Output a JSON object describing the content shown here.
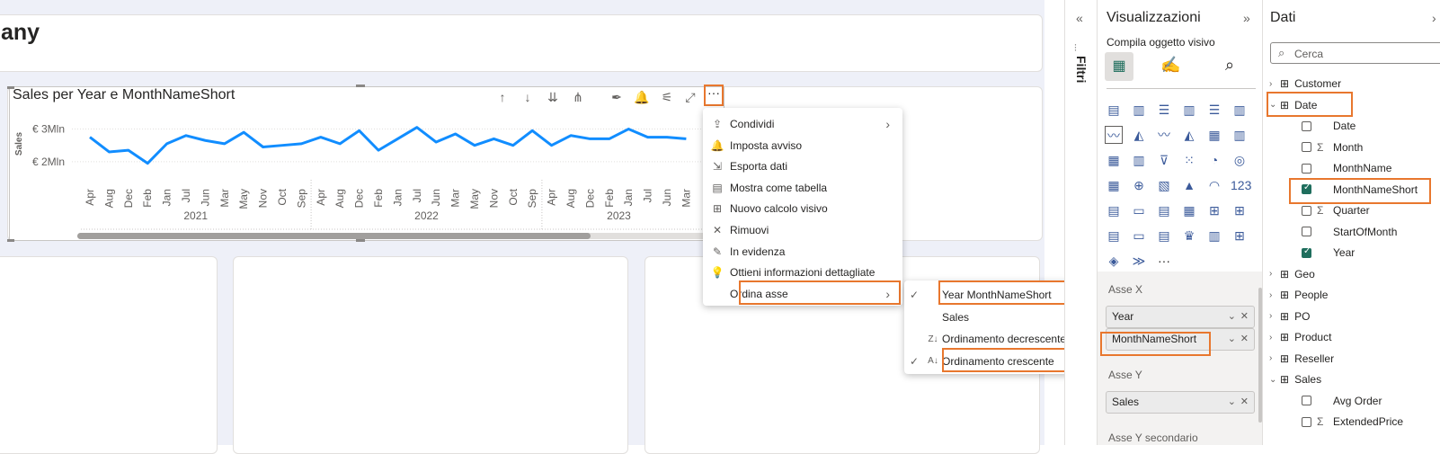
{
  "report": {
    "page_title": "any",
    "visual_title": "Sales per Year e MonthNameShort"
  },
  "visual_header": {
    "more_label": "···"
  },
  "chart_data": {
    "type": "line",
    "title": "Sales per Year e MonthNameShort",
    "ylabel": "Sales",
    "ytick_labels": [
      "€ 3Mln",
      "€ 2Mln"
    ],
    "yticks": [
      3000000,
      2000000
    ],
    "ylim": [
      1500000,
      3400000
    ],
    "x": [
      "Apr",
      "Aug",
      "Dec",
      "Feb",
      "Jan",
      "Jul",
      "Jun",
      "Mar",
      "May",
      "Nov",
      "Oct",
      "Sep",
      "Apr",
      "Aug",
      "Dec",
      "Feb",
      "Jan",
      "Jul",
      "Jun",
      "Mar",
      "May",
      "Nov",
      "Oct",
      "Sep",
      "Apr",
      "Aug",
      "Dec",
      "Feb",
      "Jan",
      "Jul",
      "Jun",
      "Mar"
    ],
    "x_groups": [
      {
        "label": "2021",
        "count": 12
      },
      {
        "label": "2022",
        "count": 12
      },
      {
        "label": "2023",
        "count": 8
      }
    ],
    "series": [
      {
        "values": [
          2750000,
          2300000,
          2350000,
          1950000,
          2550000,
          2800000,
          2650000,
          2550000,
          2900000,
          2450000,
          2500000,
          2550000,
          2750000,
          2550000,
          2950000,
          2350000,
          2700000,
          3050000,
          2600000,
          2850000,
          2500000,
          2700000,
          2500000,
          2950000,
          2500000,
          2800000,
          2700000,
          2700000,
          3000000,
          2750000,
          2750000,
          2700000
        ],
        "color": "#118dff"
      }
    ]
  },
  "context_menu": {
    "items": [
      {
        "icon": "share-icon",
        "glyph": "⇪",
        "label": "Condividi",
        "arrow": true
      },
      {
        "icon": "bell-icon",
        "glyph": "🔔",
        "label": "Imposta avviso",
        "arrow": false
      },
      {
        "icon": "export-icon",
        "glyph": "⇲",
        "label": "Esporta dati",
        "arrow": false
      },
      {
        "icon": "table-icon",
        "glyph": "▤",
        "label": "Mostra come tabella",
        "arrow": false
      },
      {
        "icon": "calc-icon",
        "glyph": "⊞",
        "label": "Nuovo calcolo visivo",
        "arrow": false
      },
      {
        "icon": "close-icon",
        "glyph": "✕",
        "label": "Rimuovi",
        "arrow": false
      },
      {
        "icon": "spotlight-icon",
        "glyph": "✎",
        "label": "In evidenza",
        "arrow": false
      },
      {
        "icon": "lightbulb-icon",
        "glyph": "💡",
        "label": "Ottieni informazioni dettagliate",
        "arrow": false
      },
      {
        "icon": "",
        "glyph": "",
        "label": "Ordina asse",
        "arrow": true
      }
    ]
  },
  "sort_submenu": {
    "items": [
      {
        "check": "✓",
        "icon": "",
        "label": "Year MonthNameShort"
      },
      {
        "check": "",
        "icon": "",
        "label": "Sales"
      },
      {
        "check": "",
        "icon": "Z↓",
        "label": "Ordinamento decrescente"
      },
      {
        "check": "✓",
        "icon": "A↓",
        "label": "Ordinamento crescente"
      }
    ]
  },
  "filters_pane": {
    "label": "Filtri",
    "collapse": "«"
  },
  "viz_pane": {
    "title": "Visualizzazioni",
    "expand": "»",
    "subtitle": "Compila oggetto visivo",
    "more_label": "···",
    "icons": [
      "▤",
      "▥",
      "☰",
      "▥",
      "☰",
      "▥",
      "〰",
      "◭",
      "〰",
      "◭",
      "▦",
      "▥",
      "▦",
      "▥",
      "⊽",
      "⁙",
      "◔",
      "◎",
      "▦",
      "⊕",
      "▧",
      "▲",
      "◠",
      "123",
      "▤",
      "▭",
      "▤",
      "▦",
      "⊞",
      "⊞",
      "▤",
      "▭",
      "▤",
      "♛",
      "▥",
      "⊞",
      "◈",
      "≫"
    ],
    "wells": [
      {
        "label": "Asse X",
        "fields": [
          "Year",
          "MonthNameShort"
        ]
      },
      {
        "label": "Asse Y",
        "fields": [
          "Sales"
        ]
      },
      {
        "label": "Asse Y secondario",
        "fields": []
      }
    ]
  },
  "data_pane": {
    "title": "Dati",
    "search_placeholder": "Cerca",
    "tree": [
      {
        "type": "table",
        "label": "Customer",
        "expanded": false,
        "level": 0
      },
      {
        "type": "table",
        "label": "Date",
        "expanded": true,
        "level": 0
      },
      {
        "type": "field",
        "label": "Date",
        "checked": false,
        "sigma": false
      },
      {
        "type": "field",
        "label": "Month",
        "checked": false,
        "sigma": true
      },
      {
        "type": "field",
        "label": "MonthName",
        "checked": false,
        "sigma": false
      },
      {
        "type": "field",
        "label": "MonthNameShort",
        "checked": true,
        "sigma": false
      },
      {
        "type": "field",
        "label": "Quarter",
        "checked": false,
        "sigma": true
      },
      {
        "type": "field",
        "label": "StartOfMonth",
        "checked": false,
        "sigma": false
      },
      {
        "type": "field",
        "label": "Year",
        "checked": true,
        "sigma": false
      },
      {
        "type": "table",
        "label": "Geo",
        "expanded": false,
        "level": 0
      },
      {
        "type": "table",
        "label": "People",
        "expanded": false,
        "level": 0
      },
      {
        "type": "table",
        "label": "PO",
        "expanded": false,
        "level": 0
      },
      {
        "type": "table",
        "label": "Product",
        "expanded": false,
        "level": 0
      },
      {
        "type": "table",
        "label": "Reseller",
        "expanded": false,
        "level": 0
      },
      {
        "type": "table",
        "label": "Sales",
        "expanded": true,
        "level": 0
      },
      {
        "type": "field",
        "label": "Avg Order",
        "checked": false,
        "sigma": false
      },
      {
        "type": "field",
        "label": "ExtendedPrice",
        "checked": false,
        "sigma": true
      }
    ]
  },
  "colors": {
    "highlight": "#e8772e",
    "series": "#118dff",
    "check": "#1f6e5d"
  }
}
